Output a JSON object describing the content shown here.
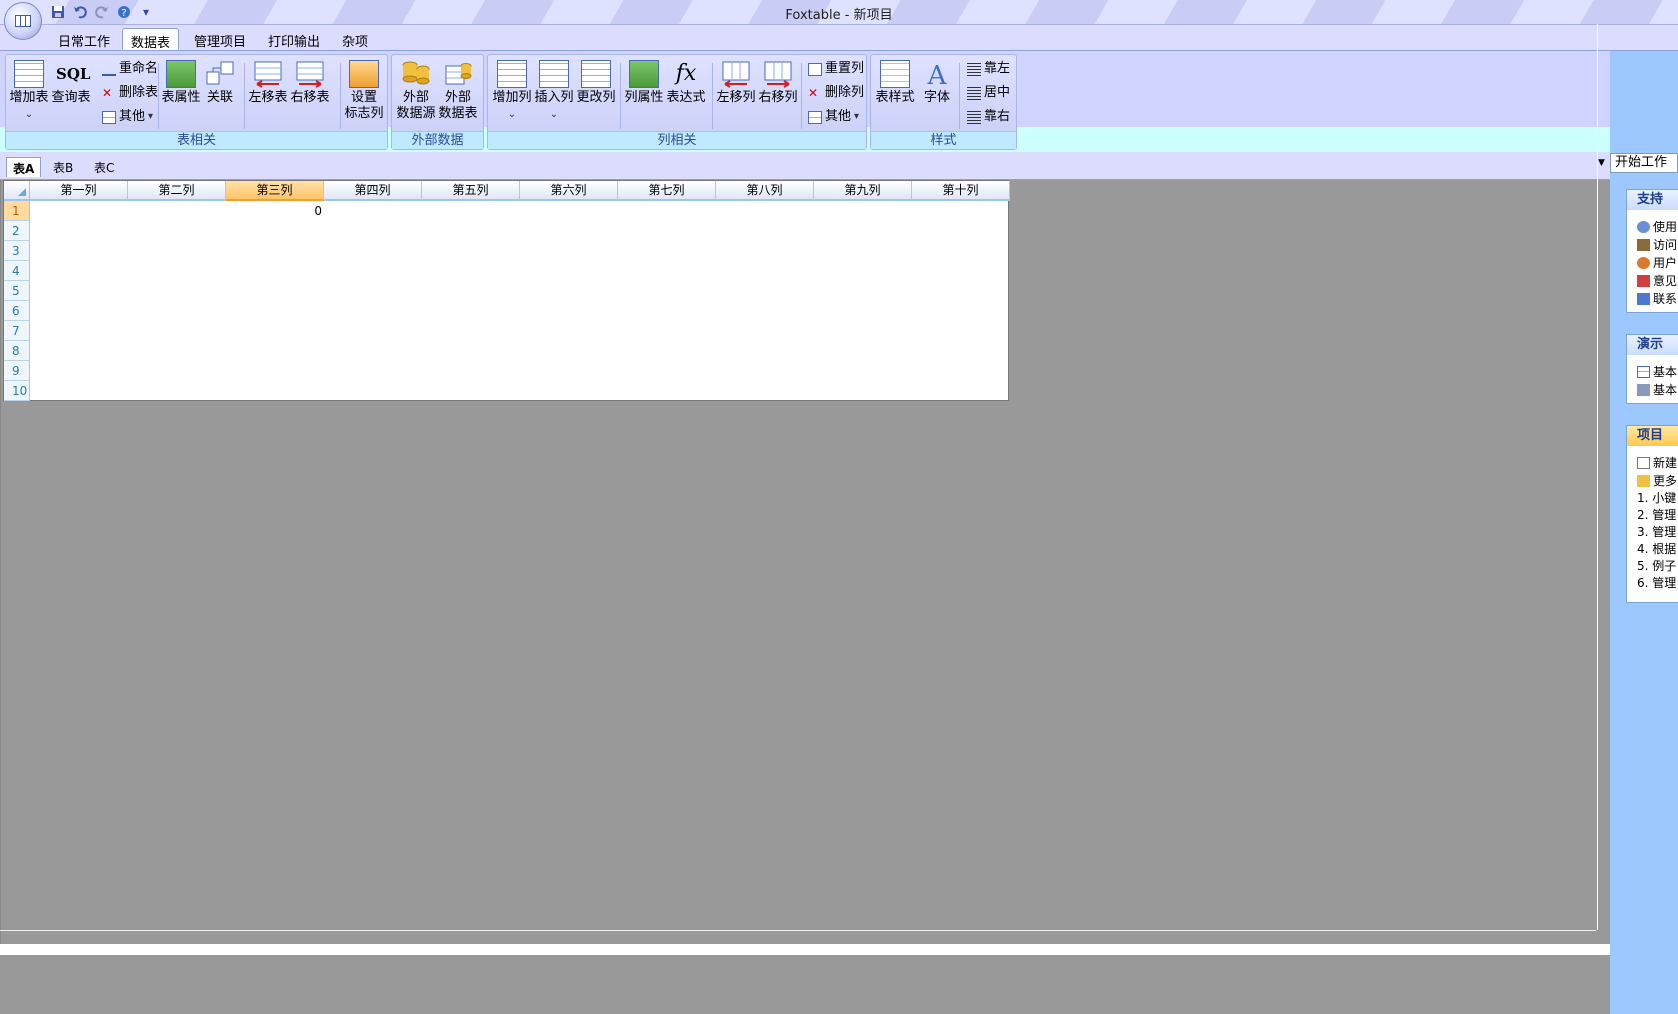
{
  "window": {
    "title": "Foxtable - 新项目"
  },
  "qat": {
    "save_icon": "save-icon",
    "undo_icon": "undo-icon",
    "redo_icon": "redo-icon",
    "help_icon": "help-icon",
    "customize": "▾"
  },
  "menu": {
    "tabs": [
      "日常工作",
      "数据表",
      "管理项目",
      "打印输出",
      "杂项"
    ],
    "active_tab": "数据表"
  },
  "ribbon": {
    "group_table": {
      "label": "表相关",
      "add_table": "增加表",
      "query_table": "查询表",
      "sql_glyph": "SQL",
      "rename": "重命名",
      "delete_table": "删除表",
      "other": "其他",
      "table_props": "表属性",
      "relation": "关联",
      "move_left": "左移表",
      "move_right": "右移表",
      "set_flag_col_1": "设置",
      "set_flag_col_2": "标志列"
    },
    "group_external": {
      "label": "外部数据",
      "ext_source_1": "外部",
      "ext_source_2": "数据源",
      "ext_table_1": "外部",
      "ext_table_2": "数据表"
    },
    "group_column": {
      "label": "列相关",
      "add_col": "增加列",
      "insert_col": "插入列",
      "change_col": "更改列",
      "col_props": "列属性",
      "expression": "表达式",
      "fx_glyph": "fx",
      "col_left": "左移列",
      "col_right": "右移列",
      "reset_col": "重置列",
      "delete_col": "删除列",
      "other": "其他"
    },
    "group_style": {
      "label": "样式",
      "table_style": "表样式",
      "font": "字体",
      "align_left": "靠左",
      "align_center": "居中",
      "align_right": "靠右"
    }
  },
  "sheets": {
    "tabs": [
      "表A",
      "表B",
      "表C"
    ],
    "active": "表A"
  },
  "grid": {
    "columns": [
      "第一列",
      "第二列",
      "第三列",
      "第四列",
      "第五列",
      "第六列",
      "第七列",
      "第八列",
      "第九列",
      "第十列"
    ],
    "selected_column": "第三列",
    "rows": [
      "1",
      "2",
      "3",
      "4",
      "5",
      "6",
      "7",
      "8",
      "9",
      "10"
    ],
    "selected_row": "1",
    "cell_r1_c3": "0"
  },
  "taskpane": {
    "header": "开始工作",
    "support": {
      "title": "支持",
      "items": [
        "使用",
        "访问",
        "用户",
        "意见",
        "联系"
      ]
    },
    "demo": {
      "title": "演示",
      "items": [
        "基本",
        "基本"
      ]
    },
    "project": {
      "title": "项目",
      "items": [
        "新建",
        "更多"
      ],
      "recent": [
        "1. 小键",
        "2. 管理",
        "3. 管理",
        "4. 根据",
        "5. 例子",
        "6. 管理"
      ]
    }
  }
}
